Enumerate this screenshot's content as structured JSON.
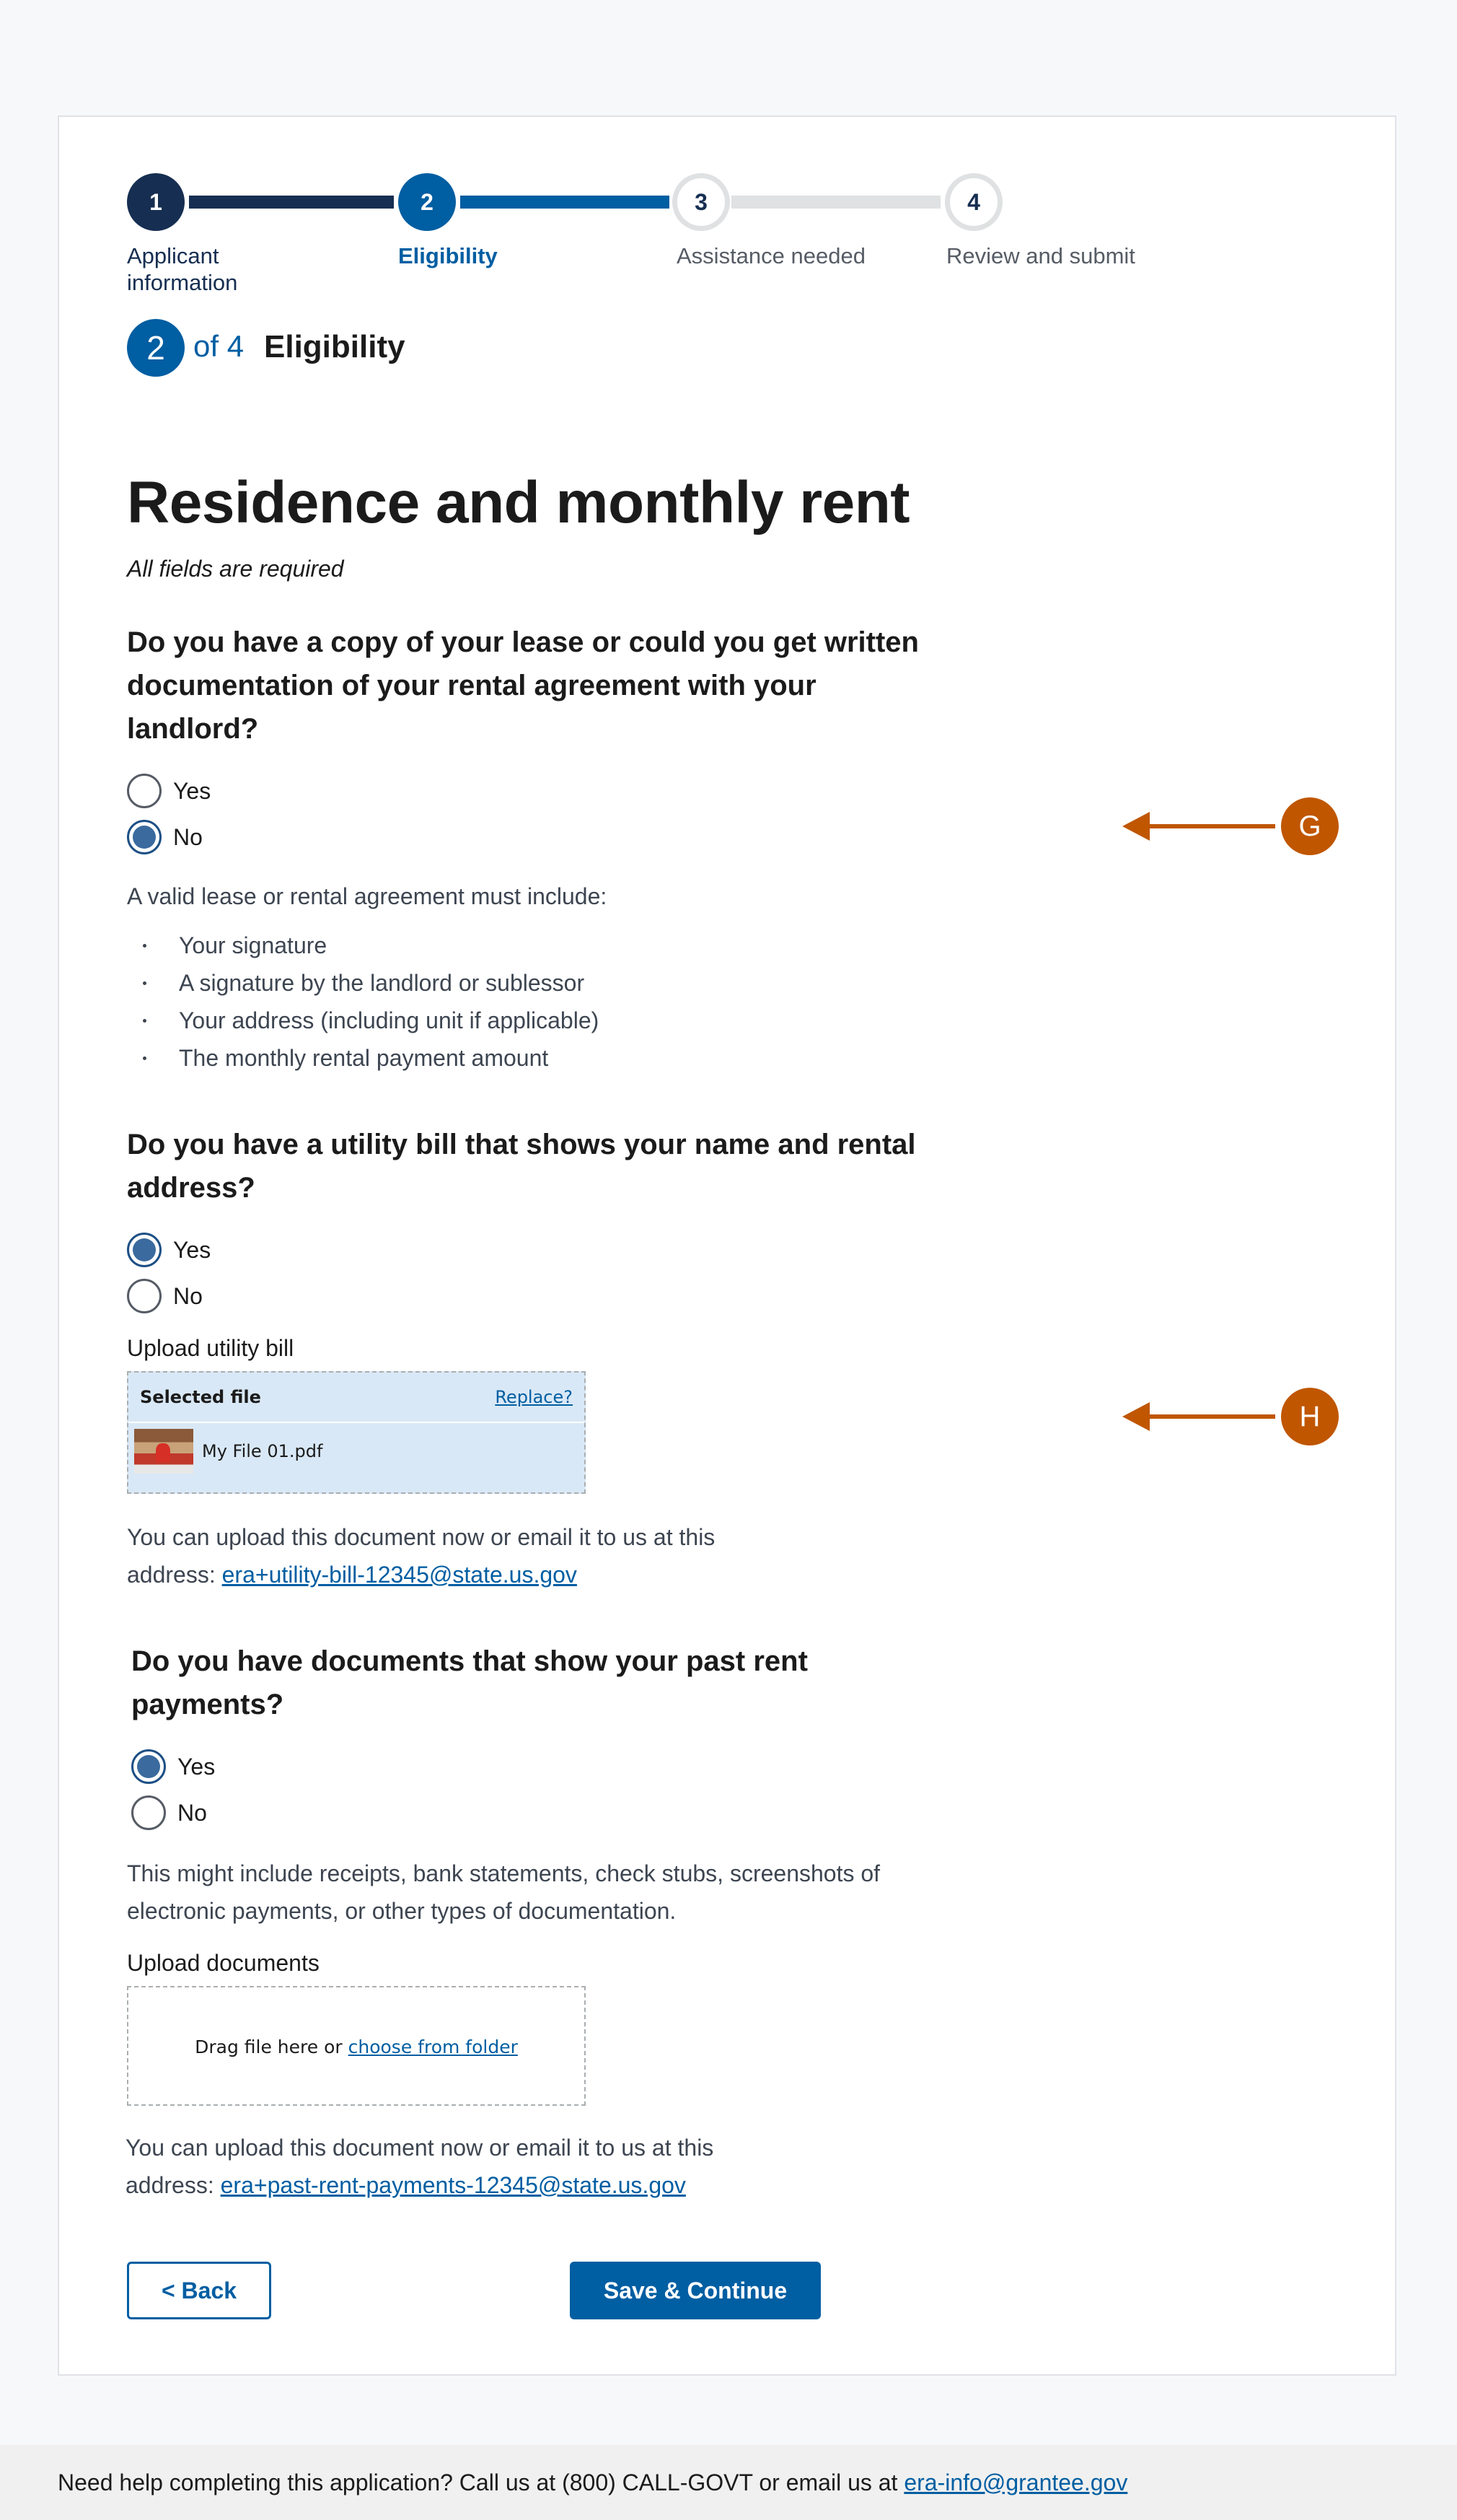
{
  "steps": [
    {
      "number": "1",
      "label": "Applicant information",
      "state": "complete"
    },
    {
      "number": "2",
      "label": "Eligibility",
      "state": "current"
    },
    {
      "number": "3",
      "label": "Assistance needed",
      "state": "upcoming"
    },
    {
      "number": "4",
      "label": "Review and submit",
      "state": "upcoming"
    }
  ],
  "step_counter": {
    "current": "2",
    "of_text": "of 4",
    "heading": "Eligibility"
  },
  "page_title": "Residence and monthly rent",
  "required_note": "All fields are required",
  "lease_question": {
    "text": "Do you have a copy of your lease or could you get written documentation of your rental agreement with your landlord?",
    "options": [
      {
        "label": "Yes",
        "checked": false
      },
      {
        "label": "No",
        "checked": true
      }
    ],
    "info_text": "A valid lease or rental agreement must include:",
    "requirements": [
      "Your signature",
      "A signature by the landlord or sublessor",
      "Your address (including unit if applicable)",
      "The monthly rental payment amount"
    ]
  },
  "utility_question": {
    "text": "Do you have a utility bill that shows your name and rental address?",
    "options": [
      {
        "label": "Yes",
        "checked": true
      },
      {
        "label": "No",
        "checked": false
      }
    ],
    "upload_label": "Upload utility bill",
    "selected_file_title": "Selected file",
    "replace_link": "Replace?",
    "file_name": "My File 01.pdf",
    "note_text": "You can upload this document now or email it to us at this address:",
    "email": "era+utility-bill-12345@state.us.gov"
  },
  "past_rent_question": {
    "text": "Do you have documents that show your past rent payments?",
    "options": [
      {
        "label": "Yes",
        "checked": true
      },
      {
        "label": "No",
        "checked": false
      }
    ],
    "info_text": "This might include receipts, bank statements, check stubs, screenshots of electronic payments, or other types of documentation.",
    "upload_label": "Upload documents",
    "drop_text": "Drag file here or",
    "choose_link": "choose from folder",
    "note_text": "You can upload this document now or email it to us at this address:",
    "email": "era+past-rent-payments-12345@state.us.gov"
  },
  "buttons": {
    "back": "< Back",
    "save": "Save & Continue"
  },
  "annotations": {
    "marker_g": "G",
    "marker_h": "H",
    "color": "#c05600"
  },
  "footer": {
    "text": "Need help completing this application? Call us at (800) CALL-GOVT or email us at",
    "email": "era-info@grantee.gov"
  },
  "colors": {
    "primary": "#005ea2",
    "complete": "#162e51",
    "accent": "#c05600"
  }
}
